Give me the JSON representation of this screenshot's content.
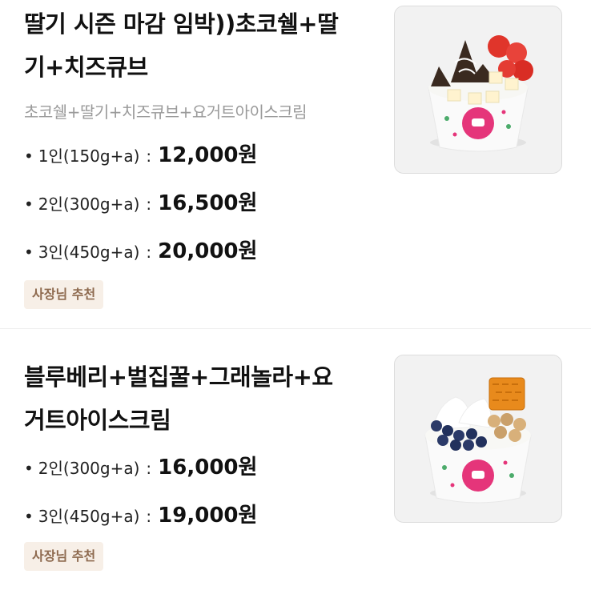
{
  "items": [
    {
      "title_line1": "딸기 시즌 마감 임박))초코쉘+딸",
      "title_line2": "기+치즈큐브",
      "description": "초코쉘+딸기+치즈큐브+요거트아이스크림",
      "options": [
        {
          "label": "1인(150g+a)",
          "price": "12,000원"
        },
        {
          "label": "2인(300g+a)",
          "price": "16,500원"
        },
        {
          "label": "3인(450g+a)",
          "price": "20,000원"
        }
      ],
      "badge": "사장님 추천",
      "image_icon": "yogurt-bowl-strawberry-chocolate-icon"
    },
    {
      "title_line1": "블루베리+벌집꿀+그래놀라+요",
      "title_line2": "거트아이스크림",
      "options": [
        {
          "label": "2인(300g+a)",
          "price": "16,000원"
        },
        {
          "label": "3인(450g+a)",
          "price": "19,000원"
        }
      ],
      "badge": "사장님 추천",
      "image_icon": "yogurt-bowl-blueberry-honeycomb-icon"
    }
  ],
  "separator": ":",
  "bullet": "•"
}
